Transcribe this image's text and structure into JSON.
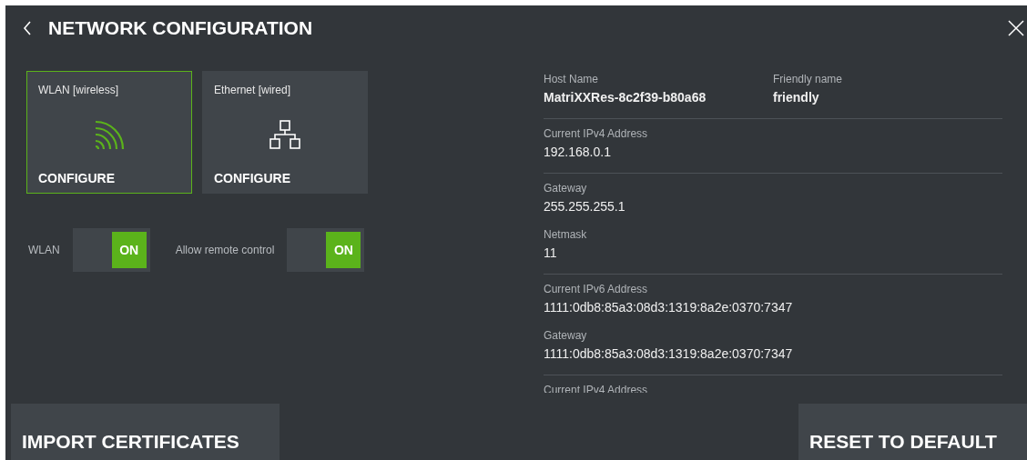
{
  "header": {
    "title": "NETWORK CONFIGURATION"
  },
  "cards": [
    {
      "kind": "wireless",
      "label": "WLAN [wireless]",
      "action": "CONFIGURE",
      "selected": true
    },
    {
      "kind": "wired",
      "label": "Ethernet [wired]",
      "action": "CONFIGURE",
      "selected": false
    }
  ],
  "toggles": [
    {
      "label": "WLAN",
      "on": true,
      "state_text": "ON"
    },
    {
      "label": "Allow remote control",
      "on": true,
      "state_text": "ON"
    }
  ],
  "sections": [
    {
      "kind": "pair",
      "fields": [
        {
          "label": "Host Name",
          "value": "MatriXXRes-8c2f39-b80a68"
        },
        {
          "label": "Friendly name",
          "value": "friendly"
        }
      ]
    },
    {
      "kind": "stack",
      "fields": [
        {
          "label": "Current IPv4 Address",
          "value": "192.168.0.1"
        }
      ]
    },
    {
      "kind": "stack",
      "fields": [
        {
          "label": "Gateway",
          "value": "255.255.255.1"
        },
        {
          "label": "Netmask",
          "value": "11"
        }
      ]
    },
    {
      "kind": "stack",
      "fields": [
        {
          "label": "Current IPv6 Address",
          "value": "1111:0db8:85a3:08d3:1319:8a2e:0370:7347"
        },
        {
          "label": "Gateway",
          "value": "1111:0db8:85a3:08d3:1319:8a2e:0370:7347"
        }
      ]
    },
    {
      "kind": "stack",
      "fields": [
        {
          "label": "Current IPv4 Address"
        }
      ]
    }
  ],
  "footer": {
    "buttons": [
      "IMPORT CERTIFICATES",
      "RESET TO DEFAULT"
    ]
  }
}
